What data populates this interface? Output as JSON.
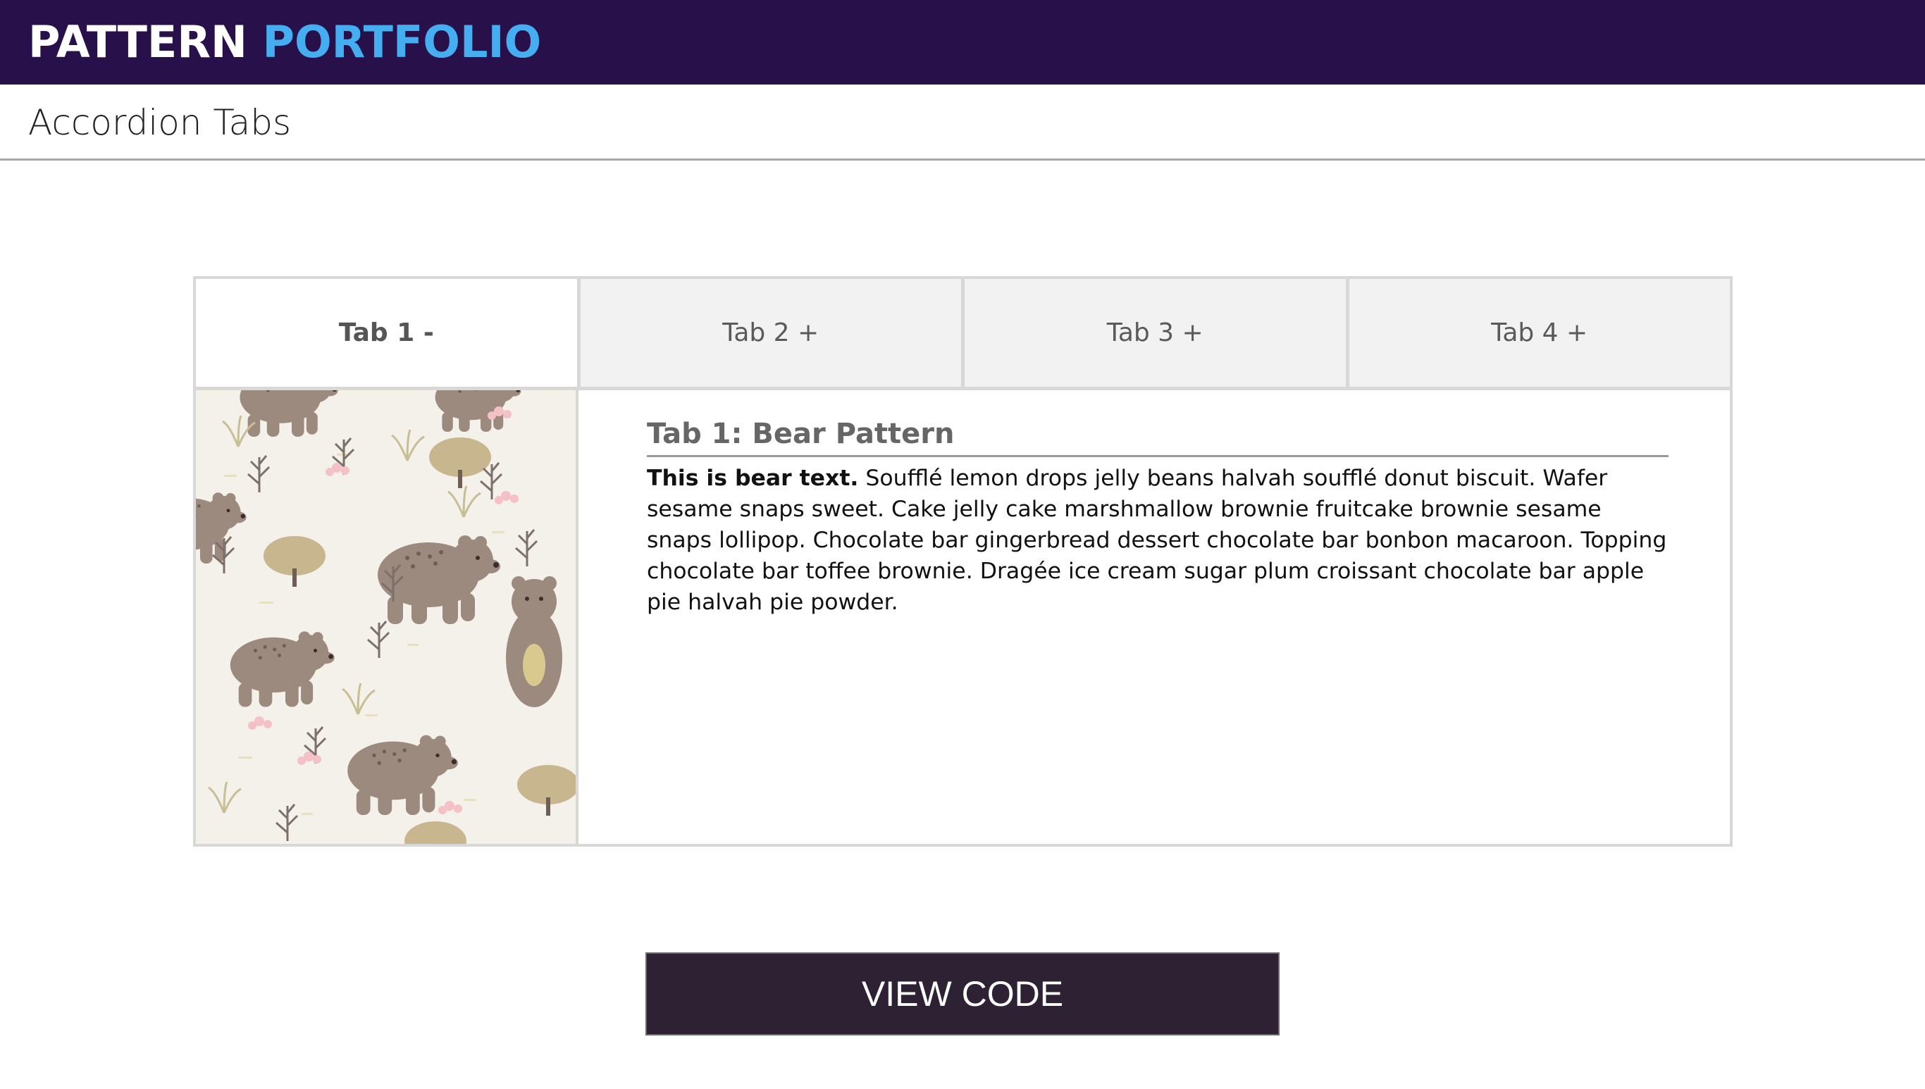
{
  "header": {
    "brand_part1": "PATTERN",
    "brand_part2": "PORTFOLIO"
  },
  "page": {
    "title": "Accordion Tabs"
  },
  "tabs": [
    {
      "label": "Tab 1 -",
      "active": true
    },
    {
      "label": "Tab 2 +",
      "active": false
    },
    {
      "label": "Tab 3 +",
      "active": false
    },
    {
      "label": "Tab 4 +",
      "active": false
    }
  ],
  "panel": {
    "image_icon": "bear-pattern-image",
    "heading": "Tab 1: Bear Pattern",
    "body_bold": "This is bear text.",
    "body_text": " Soufflé lemon drops jelly beans halvah soufflé donut biscuit. Wafer sesame snaps sweet. Cake jelly cake marshmallow brownie fruitcake brownie sesame snaps lollipop. Chocolate bar gingerbread dessert chocolate bar bonbon macaroon. Topping chocolate bar toffee brownie. Dragée ice cream sugar plum croissant chocolate bar apple pie halvah pie powder."
  },
  "actions": {
    "view_code_label": "VIEW CODE"
  },
  "colors": {
    "topbar": "#28104a",
    "brand_accent": "#45aef0",
    "button": "#2e2133"
  }
}
